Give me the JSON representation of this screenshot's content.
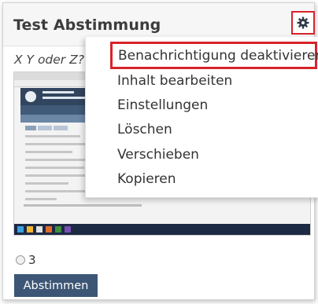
{
  "widget": {
    "title": "Test Abstimmung",
    "question": "X Y oder Z?",
    "option_label": "3",
    "vote_button": "Abstimmen",
    "settings_icon": "gear-icon"
  },
  "menu": {
    "items": [
      {
        "label": "Benachrichtigung deaktivieren",
        "highlighted": true
      },
      {
        "label": "Inhalt bearbeiten"
      },
      {
        "label": "Einstellungen"
      },
      {
        "label": "Löschen"
      },
      {
        "label": "Verschieben"
      },
      {
        "label": "Kopieren"
      }
    ]
  },
  "colors": {
    "accent_red": "#d8232a",
    "button_blue": "#3d5675"
  }
}
